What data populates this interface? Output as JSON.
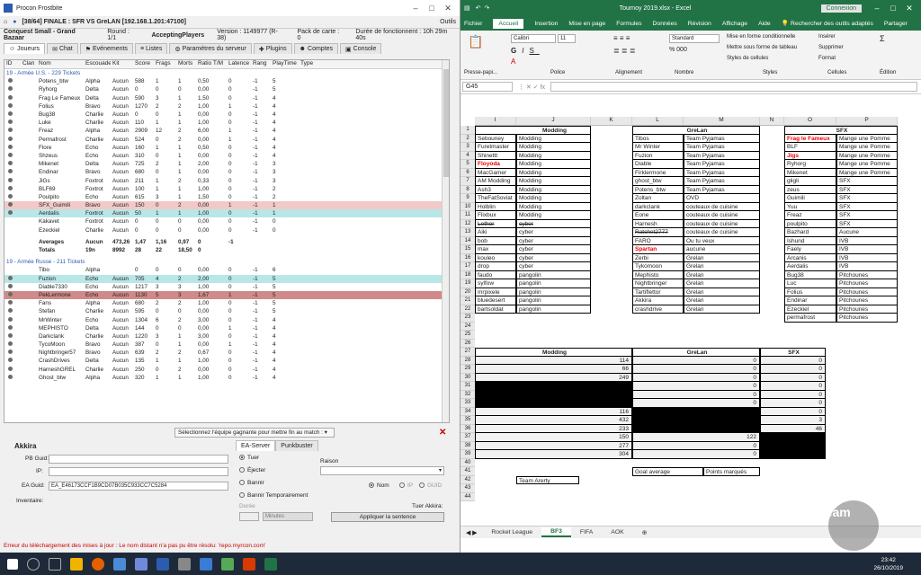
{
  "procon": {
    "title": "Procon Frostbite",
    "server_line": "[38/64] FINALE : SFR VS GreLAN [192.168.1.201:47100]",
    "outils": "Outils",
    "map": "Conquest Small - Grand Bazaar",
    "round": "Round : 1/1",
    "state": "AcceptingPlayers",
    "version": "Version : 1149977 (R-38)",
    "pack": "Pack de carte : 0",
    "uptime": "Durée de fonctionnent : 10h 29m 40s",
    "tabs": [
      "Joueurs",
      "Chat",
      "Evénements",
      "Listes",
      "Paramètres du serveur",
      "Plugins",
      "Comptes",
      "Console"
    ],
    "columns": [
      "ID",
      "Clan",
      "Nom",
      "Escouade",
      "Kit",
      "Score",
      "Frags",
      "Morts",
      "Ratio T/M",
      "Latence",
      "Rang",
      "PlayTime",
      "Type"
    ],
    "team1_header": "19 - Armée U.S. - 229 Tickets",
    "team1": [
      [
        "Potens_btw",
        "Alpha",
        "Aucun",
        "588",
        "1",
        "1",
        "0,50",
        "0",
        "-1",
        "5"
      ],
      [
        "Ryhorg",
        "Delta",
        "Aucun",
        "0",
        "0",
        "0",
        "0,00",
        "0",
        "-1",
        "5"
      ],
      [
        "Frag Le Fameux",
        "Delta",
        "Aucun",
        "590",
        "3",
        "1",
        "1,50",
        "0",
        "-1",
        "4"
      ],
      [
        "Folius",
        "Bravo",
        "Aucun",
        "1270",
        "2",
        "2",
        "1,00",
        "1",
        "-1",
        "4"
      ],
      [
        "Bug38",
        "Charlie",
        "Aucun",
        "0",
        "0",
        "1",
        "0,00",
        "0",
        "-1",
        "4"
      ],
      [
        "Luke",
        "Charlie",
        "Aucun",
        "110",
        "1",
        "1",
        "1,00",
        "0",
        "-1",
        "4"
      ],
      [
        "Freaz",
        "Alpha",
        "Aucun",
        "2909",
        "12",
        "2",
        "6,00",
        "1",
        "-1",
        "4"
      ],
      [
        "Permafrost",
        "Charlie",
        "Aucun",
        "524",
        "0",
        "2",
        "0,00",
        "1",
        "-1",
        "4"
      ],
      [
        "Flore",
        "Echo",
        "Aucun",
        "160",
        "1",
        "1",
        "0,50",
        "0",
        "-1",
        "4"
      ],
      [
        "Shzeus",
        "Echo",
        "Aucun",
        "310",
        "0",
        "1",
        "0,00",
        "0",
        "-1",
        "4"
      ],
      [
        "Mikenet",
        "Delta",
        "Aucun",
        "725",
        "2",
        "1",
        "2,00",
        "0",
        "-1",
        "3"
      ],
      [
        "Endinar",
        "Bravo",
        "Aucun",
        "680",
        "0",
        "1",
        "0,00",
        "0",
        "-1",
        "3"
      ],
      [
        "JiGs",
        "Foxtrot",
        "Aucun",
        "211",
        "1",
        "2",
        "0,33",
        "0",
        "-1",
        "3"
      ],
      [
        "BLF69",
        "Foxtrot",
        "Aucun",
        "100",
        "1",
        "1",
        "1,00",
        "0",
        "-1",
        "2"
      ],
      [
        "Poulpito",
        "Echo",
        "Aucun",
        "615",
        "3",
        "1",
        "1,50",
        "0",
        "-1",
        "2"
      ],
      [
        "SFX_Guimili",
        "Bravo",
        "Aucun",
        "150",
        "0",
        "2",
        "0,00",
        "1",
        "-1",
        "1"
      ],
      [
        "Aerdalis",
        "Foxtrot",
        "Aucun",
        "50",
        "1",
        "1",
        "1,00",
        "0",
        "-1",
        "1"
      ],
      [
        "Kakavet",
        "Foxtrot",
        "Aucun",
        "0",
        "0",
        "0",
        "0,00",
        "0",
        "-1",
        "0"
      ],
      [
        "Ezeckiel",
        "Charlie",
        "Aucun",
        "0",
        "0",
        "0",
        "0,00",
        "0",
        "-1",
        "0"
      ]
    ],
    "team1_avg": [
      "Averages",
      "Aucun",
      "473,26",
      "1,47",
      "1,16",
      "0,97",
      "0",
      "-1"
    ],
    "team1_tot": [
      "Totals",
      "19n",
      "8992",
      "28",
      "22",
      "18,50",
      "0",
      ""
    ],
    "team2_header": "19 - Armée Russe - 211 Tickets",
    "team2": [
      [
        "Tibo",
        "Alpha",
        "",
        "0",
        "0",
        "0",
        "0,00",
        "0",
        "-1",
        "6"
      ],
      [
        "Fuzion",
        "Echo",
        "Aucun",
        "705",
        "4",
        "2",
        "2,00",
        "0",
        "-1",
        "5"
      ],
      [
        "Diable7330",
        "Echo",
        "Aucun",
        "1217",
        "3",
        "3",
        "1,00",
        "0",
        "-1",
        "5"
      ],
      [
        "PekLermone",
        "Echo",
        "Aucun",
        "1130",
        "5",
        "3",
        "1,67",
        "1",
        "-1",
        "5"
      ],
      [
        "Fans",
        "Alpha",
        "Aucun",
        "680",
        "2",
        "2",
        "1,00",
        "0",
        "-1",
        "5"
      ],
      [
        "Stefan",
        "Charlie",
        "Aucun",
        "595",
        "0",
        "0",
        "0,00",
        "0",
        "-1",
        "5"
      ],
      [
        "MrWinter",
        "Echo",
        "Aucun",
        "1304",
        "6",
        "2",
        "3,00",
        "0",
        "-1",
        "4"
      ],
      [
        "MEPHISTO",
        "Delta",
        "Aucun",
        "144",
        "0",
        "0",
        "0,00",
        "1",
        "-1",
        "4"
      ],
      [
        "Darkclank",
        "Charlie",
        "Aucun",
        "1220",
        "3",
        "1",
        "3,00",
        "0",
        "-1",
        "4"
      ],
      [
        "TycoMoon",
        "Bravo",
        "Aucun",
        "387",
        "0",
        "1",
        "0,00",
        "1",
        "-1",
        "4"
      ],
      [
        "Nightbringer57",
        "Bravo",
        "Aucun",
        "639",
        "2",
        "2",
        "0,67",
        "0",
        "-1",
        "4"
      ],
      [
        "CrashDrives",
        "Delta",
        "Aucun",
        "135",
        "1",
        "1",
        "1,00",
        "0",
        "-1",
        "4"
      ],
      [
        "HarneshGREL",
        "Charlie",
        "Aucun",
        "250",
        "0",
        "2",
        "0,00",
        "0",
        "-1",
        "4"
      ],
      [
        "Ghost_btw",
        "Alpha",
        "Aucun",
        "320",
        "1",
        "1",
        "1,00",
        "0",
        "-1",
        "4"
      ]
    ],
    "winner_select": "Sélectionnez l'équipe gagnante pour mettre fin au match :",
    "player_name": "Akkira",
    "pb_guid_label": "PB Guid:",
    "ip_label": "IP:",
    "ea_guid_label": "EA Guid:",
    "ea_guid": "EA_E46173CCF1B9CD07B035C933CC7C5284",
    "inventaire": "Inventaire:",
    "ea_server_tab": "EA-Server",
    "punkbuster_tab": "Punkbuster",
    "actions": [
      "Tuer",
      "Éjecter",
      "Bannir",
      "Bannir Temporairement"
    ],
    "raison": "Raison",
    "nom": "Nom",
    "ip": "IP",
    "guid": "GUID",
    "duree": "Durée",
    "minutes": "Minutes",
    "tuer_label": "Tuer Akkira:",
    "apply": "Appliquer la sentence",
    "error": "Erreur du téléchargement des mises à jour : Le nom distant n'a pas pu être résolu: 'repo.myrcon.com'"
  },
  "excel": {
    "title": "Tournoy 2019.xlsx  -  Excel",
    "connexion": "Connexion",
    "menu": [
      "Fichier",
      "Accueil",
      "Insertion",
      "Mise en page",
      "Formules",
      "Données",
      "Révision",
      "Affichage",
      "Aide",
      "Rechercher des outils adaptés",
      "Partager"
    ],
    "font": "Calibri",
    "size": "11",
    "format": "Standard",
    "groups": [
      "Presse-papi...",
      "Police",
      "Alignement",
      "Nombre",
      "Styles",
      "Cellules",
      "Édition"
    ],
    "styles": [
      "Mise en forme conditionnelle",
      "Mettre sous forme de tableau",
      "Styles de cellules"
    ],
    "cells": [
      "Insérer",
      "Supprimer",
      "Format"
    ],
    "namebox": "G45",
    "cols": [
      "I",
      "J",
      "K",
      "L",
      "M",
      "N",
      "O",
      "P"
    ],
    "modding_title": "Modding",
    "grelan_title": "GreLan",
    "sfx_title": "SFX",
    "rows": [
      [
        "Sebouney",
        "Modding",
        "Tibos",
        "Team Pyjamas",
        "Frag le Fameux",
        "Mange une Pomme"
      ],
      [
        "Furetmaster",
        "Modding",
        "Mr Winter",
        "Team Pyjamas",
        "BLF",
        "Mange une Pomme"
      ],
      [
        "Shinettt",
        "Modding",
        "Fuzion",
        "Team Pyjamas",
        "Jigs",
        "Mange une Pomme"
      ],
      [
        "Floyoda",
        "Modding",
        "Diable",
        "Team Pyjamas",
        "Ryhorg",
        "Mange une Pomme"
      ],
      [
        "MacGamer",
        "Modding",
        "Firklermone",
        "Team Pyjamas",
        "Mikenet",
        "Mange une Pomme"
      ],
      [
        "AM Modding",
        "Modding",
        "ghost_btw",
        "Team Pyjamas",
        "gligli",
        "SFX"
      ],
      [
        "Ash3",
        "Modding",
        "Potens_btw",
        "Team Pyjamas",
        "zeus",
        "SFX"
      ],
      [
        "TheFatSoviat",
        "Modding",
        "Zoltan",
        "OVD",
        "Guimili",
        "SFX"
      ],
      [
        "Holblin",
        "Modding",
        "darkclank",
        "couteaux de cuisine",
        "Yuu",
        "SFX"
      ],
      [
        "Flixbux",
        "Modding",
        "Eone",
        "couteaux de cuisine",
        "Freaz",
        "SFX"
      ],
      [
        "Lethor",
        "cyber",
        "Harnesh",
        "couteaux de cuisine",
        "poulpito",
        "SFX"
      ],
      [
        "Aiki",
        "cyber",
        "Ratchet2777",
        "couteaux de cuisine",
        "Bazhard",
        "Aucune"
      ],
      [
        "bob",
        "cyber",
        "FARO",
        "Ou tu veux",
        "Ishund",
        "IVB"
      ],
      [
        "max",
        "cyber",
        "Spartan",
        "aucune",
        "Faely",
        "IVB"
      ],
      [
        "kouleo",
        "cyber",
        "Zerbi",
        "Grelan",
        "Arcanis",
        "IVB"
      ],
      [
        "drop",
        "cyber",
        "Tykomoon",
        "Grelan",
        "Aerdalis",
        "IVB"
      ],
      [
        "faudo",
        "pangolin",
        "Mephisto",
        "Grelan",
        "Bug38",
        "Pitchounes"
      ],
      [
        "sylfow",
        "pangolin",
        "Nightbringer",
        "Grelan",
        "Luc",
        "Pitchounes"
      ],
      [
        "mrpixele",
        "pangolin",
        "Tartiflettor",
        "Grelan",
        "Folius",
        "Pitchounes"
      ],
      [
        "bluedesert",
        "pangolin",
        "Akkira",
        "Grelan",
        "Endinar",
        "Pitchounes"
      ],
      [
        "bartsoldat",
        "pangolin",
        "crashdrive",
        "Grelan",
        "Ezeckiel",
        "Pitchounes"
      ],
      [
        "",
        "",
        "",
        "",
        "permafrost",
        "Pitchounes"
      ]
    ],
    "scores_header": [
      "Modding",
      "GreLan",
      "SFX"
    ],
    "scores": [
      [
        "114",
        "0",
        "0"
      ],
      [
        "66",
        "0",
        "0"
      ],
      [
        "249",
        "0",
        "0"
      ],
      [
        "",
        "0",
        "0"
      ],
      [
        "",
        "0",
        "0"
      ],
      [
        "",
        "0",
        "0"
      ],
      [
        "116",
        "",
        "0"
      ],
      [
        "432",
        "",
        "3"
      ],
      [
        "233",
        "",
        "46"
      ],
      [
        "150",
        "122",
        ""
      ],
      [
        "277",
        "0",
        ""
      ],
      [
        "304",
        "0",
        ""
      ]
    ],
    "goal_average": "Goal average",
    "points": "Points marqués",
    "team_arerty": "Team Arerty",
    "tabs": [
      "Rocket League",
      "BF3",
      "FIFA",
      "AOK"
    ]
  },
  "clock": {
    "time": "23:42",
    "date": "26/10/2019"
  }
}
